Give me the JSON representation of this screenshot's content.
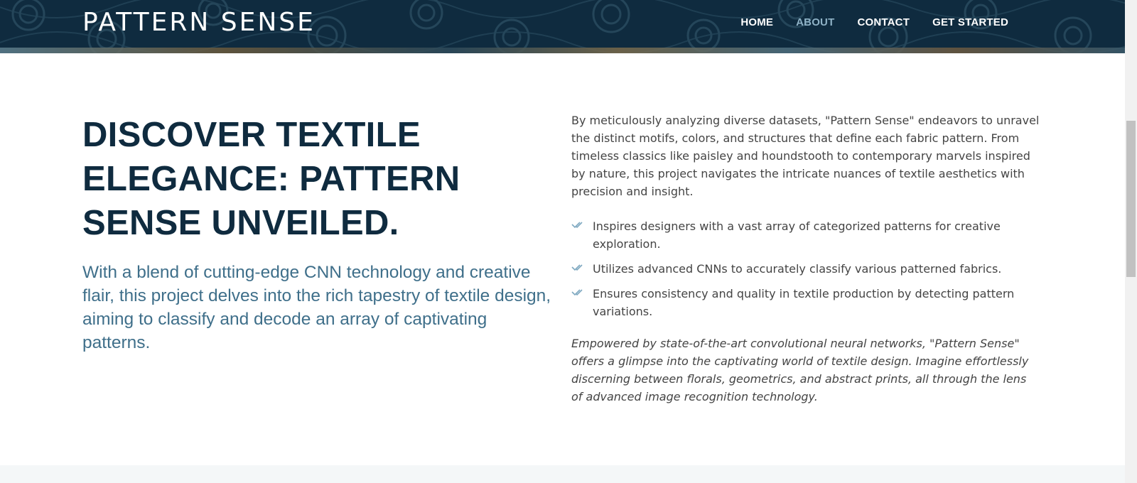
{
  "header": {
    "logo": "PATTERN SENSE",
    "nav": [
      {
        "label": "HOME",
        "active": false
      },
      {
        "label": "ABOUT",
        "active": true
      },
      {
        "label": "CONTACT",
        "active": false
      },
      {
        "label": "GET STARTED",
        "active": false
      }
    ]
  },
  "about": {
    "headline": "DISCOVER TEXTILE ELEGANCE: PATTERN SENSE UNVEILED.",
    "subheadline": "With a blend of cutting-edge CNN technology and creative flair, this project delves into the rich tapestry of textile design, aiming to classify and decode an array of captivating patterns.",
    "intro": "By meticulously analyzing diverse datasets, \"Pattern Sense\" endeavors to unravel the distinct motifs, colors, and structures that define each fabric pattern. From timeless classics like paisley and houndstooth to contemporary marvels inspired by nature, this project navigates the intricate nuances of textile aesthetics with precision and insight.",
    "features": [
      "Inspires designers with a vast array of categorized patterns for creative exploration.",
      "Utilizes advanced CNNs to accurately classify various patterned fabrics.",
      "Ensures consistency and quality in textile production by detecting pattern variations."
    ],
    "closing": "Empowered by state-of-the-art convolutional neural networks, \"Pattern Sense\" offers a glimpse into the captivating world of textile design. Imagine effortlessly discerning between florals, geometrics, and abstract prints, all through the lens of advanced image recognition technology."
  },
  "colors": {
    "header_bg": "#0f2b3f",
    "headline": "#0f2b3f",
    "subheadline": "#3f6f8a",
    "nav_active": "#8fb2c6",
    "check_icon": "#7fa9c1"
  },
  "icons": {
    "feature_bullet": "double-check-icon"
  }
}
